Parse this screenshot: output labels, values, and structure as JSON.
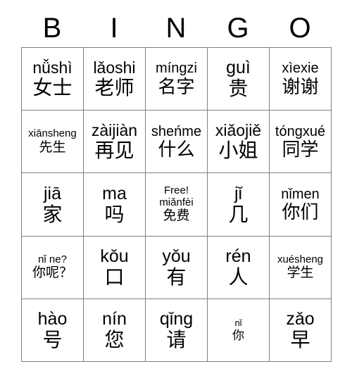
{
  "card": {
    "header_letters": [
      "B",
      "I",
      "N",
      "G",
      "O"
    ],
    "grid_size": "5x5",
    "border_color": "#808080",
    "text_color": "#000000",
    "background_color": "#ffffff"
  },
  "cells": [
    {
      "pinyin": "nǚshì",
      "hanzi": "女士",
      "size": "s-lg"
    },
    {
      "pinyin": "lǎoshi",
      "hanzi": "老师",
      "size": "s-lg"
    },
    {
      "pinyin": "míngzi",
      "hanzi": "名字",
      "size": "s-md"
    },
    {
      "pinyin": "guì",
      "hanzi": "贵",
      "size": "s-xl"
    },
    {
      "pinyin": "xìexie",
      "hanzi": "谢谢",
      "size": "s-md"
    },
    {
      "pinyin": "xiānsheng",
      "hanzi": "先生",
      "size": "s-sm"
    },
    {
      "pinyin": "zàijiàn",
      "hanzi": "再见",
      "size": "s-lg"
    },
    {
      "pinyin": "sheńme",
      "hanzi": "什么",
      "size": "s-md"
    },
    {
      "pinyin": "xiǎojiě",
      "hanzi": "小姐",
      "size": "s-lg"
    },
    {
      "pinyin": "tóngxué",
      "hanzi": "同学",
      "size": "s-md"
    },
    {
      "pinyin": "jiā",
      "hanzi": "家",
      "size": "s-xl"
    },
    {
      "pinyin": "ma",
      "hanzi": "吗",
      "size": "s-xl"
    },
    {
      "free_label": "Free!",
      "pinyin": "miǎnfèi",
      "hanzi": "免费",
      "size": "s-free",
      "is_free": true
    },
    {
      "pinyin": "jǐ",
      "hanzi": "几",
      "size": "s-xl"
    },
    {
      "pinyin": "nǐmen",
      "hanzi": "你们",
      "size": "s-md"
    },
    {
      "pinyin": "nǐ ne?",
      "hanzi": "你呢？",
      "size": "s-sm"
    },
    {
      "pinyin": "kǒu",
      "hanzi": "口",
      "size": "s-xl"
    },
    {
      "pinyin": "yǒu",
      "hanzi": "有",
      "size": "s-xl"
    },
    {
      "pinyin": "rén",
      "hanzi": "人",
      "size": "s-xl"
    },
    {
      "pinyin": "xuésheng",
      "hanzi": "学生",
      "size": "s-sm"
    },
    {
      "pinyin": "hào",
      "hanzi": "号",
      "size": "s-xl"
    },
    {
      "pinyin": "nín",
      "hanzi": "您",
      "size": "s-xl"
    },
    {
      "pinyin": "qǐng",
      "hanzi": "请",
      "size": "s-xl"
    },
    {
      "pinyin": "nǐ",
      "hanzi": "你",
      "size": "s-xs"
    },
    {
      "pinyin": "zǎo",
      "hanzi": "早",
      "size": "s-xl"
    }
  ]
}
